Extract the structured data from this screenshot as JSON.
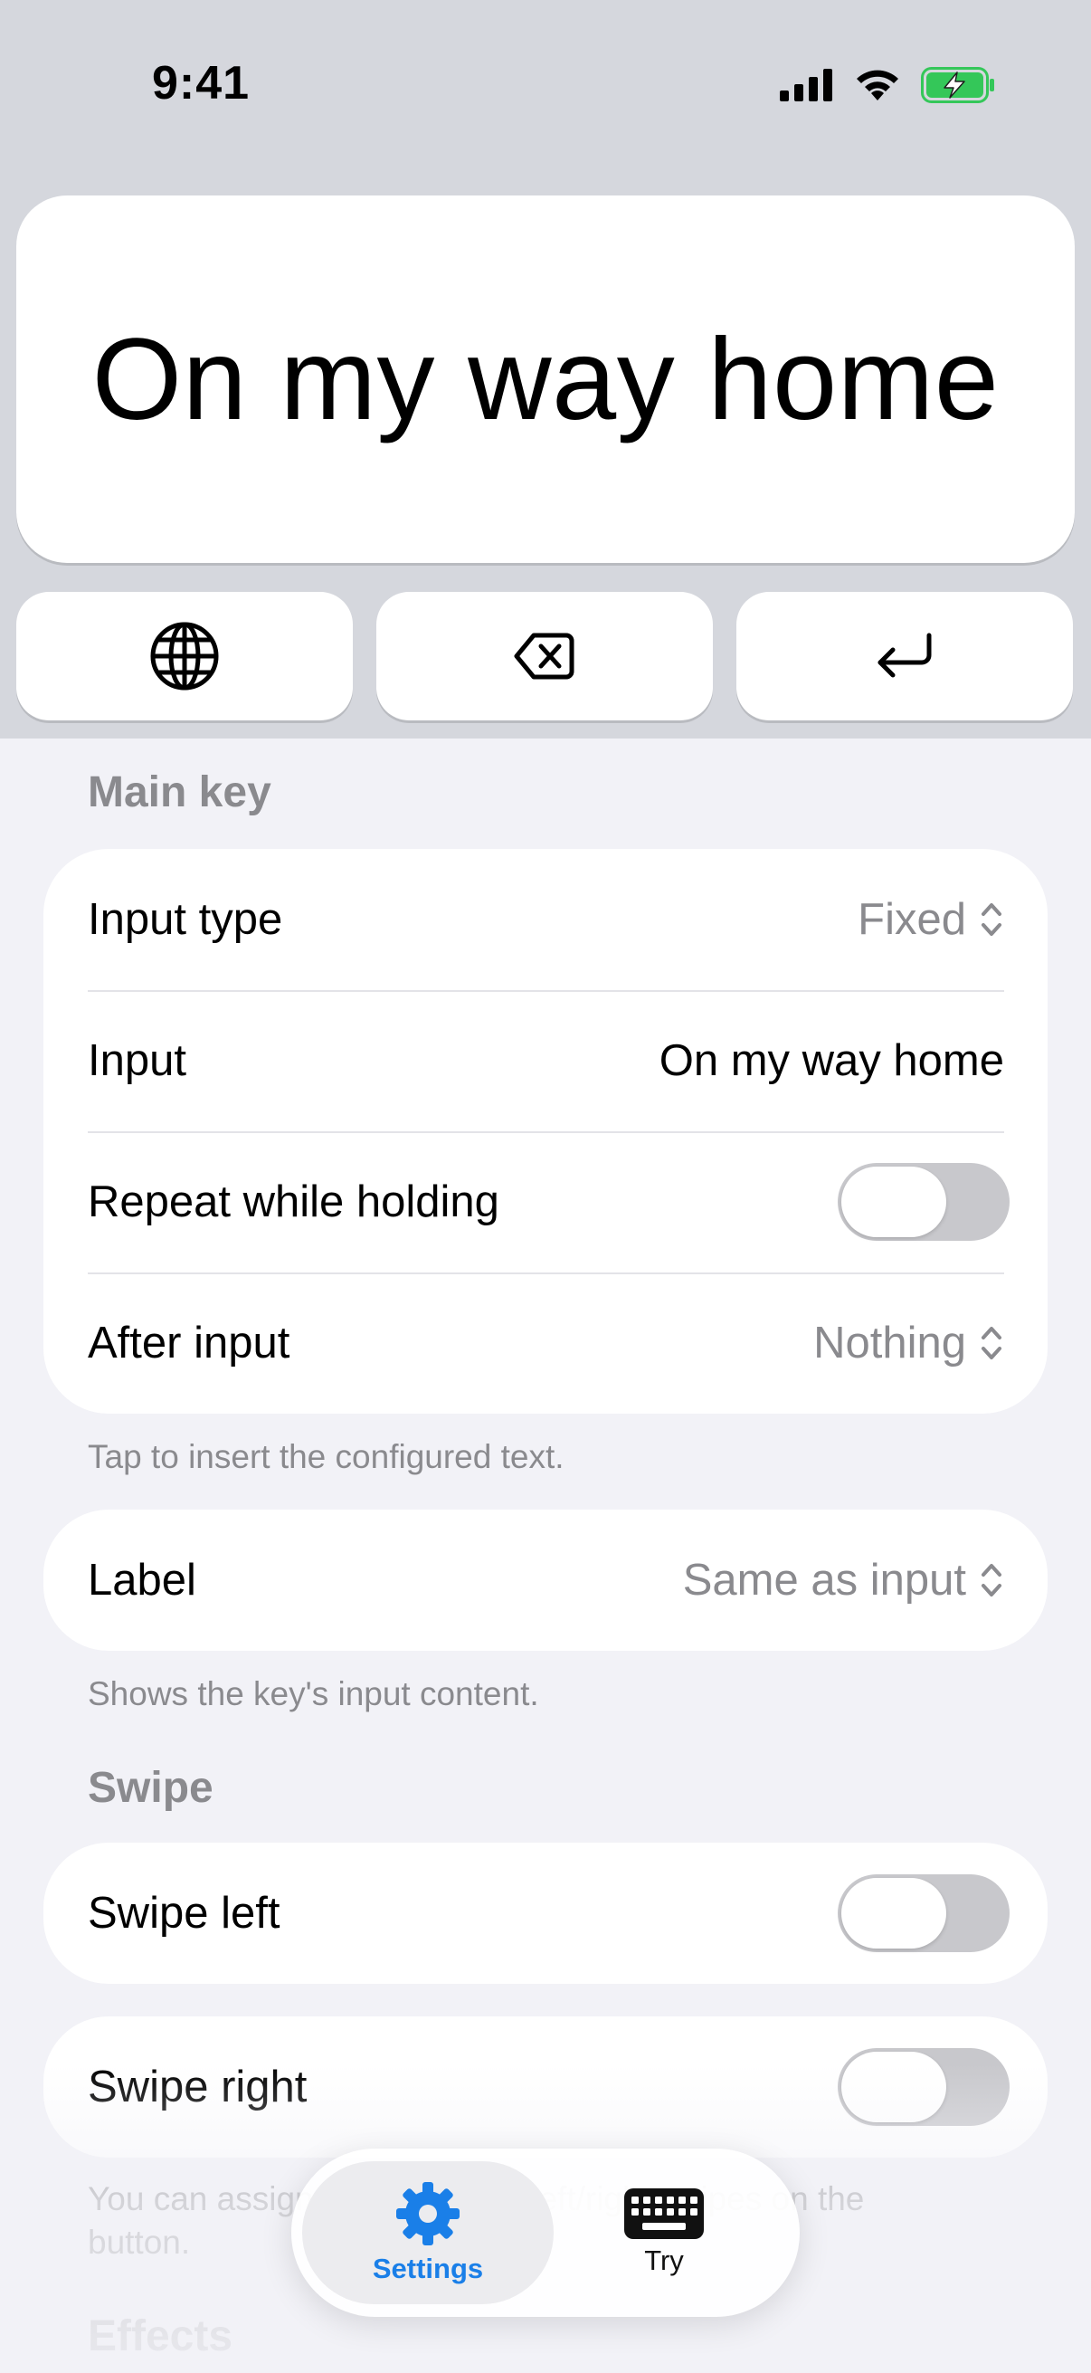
{
  "status_bar": {
    "time": "9:41"
  },
  "preview": {
    "key_text": "On my way home",
    "utility_keys": [
      {
        "icon": "globe-icon"
      },
      {
        "icon": "delete-backward-icon"
      },
      {
        "icon": "return-icon"
      }
    ]
  },
  "sections": {
    "main_key": {
      "header": "Main key",
      "rows": {
        "input_type": {
          "label": "Input type",
          "value": "Fixed"
        },
        "input": {
          "label": "Input",
          "value": "On my way home"
        },
        "repeat": {
          "label": "Repeat while holding",
          "on": false
        },
        "after_input": {
          "label": "After input",
          "value": "Nothing"
        }
      },
      "footer": "Tap to insert the configured text."
    },
    "label": {
      "label": "Label",
      "value": "Same as input",
      "footer": "Shows the key's input content."
    },
    "swipe": {
      "header": "Swipe",
      "left": {
        "label": "Swipe left",
        "on": false
      },
      "right": {
        "label": "Swipe right",
        "on": false
      },
      "footer": "You can assign actions to the left/right swipes on the button."
    },
    "effects": {
      "header": "Effects"
    }
  },
  "tabbar": {
    "tabs": [
      {
        "label": "Settings",
        "icon": "gear-icon",
        "selected": true
      },
      {
        "label": "Try",
        "icon": "keyboard-icon",
        "selected": false
      }
    ]
  },
  "colors": {
    "accent": "#1a7fe8",
    "battery": "#34c759",
    "toggle_off": "#c8c8cc"
  }
}
